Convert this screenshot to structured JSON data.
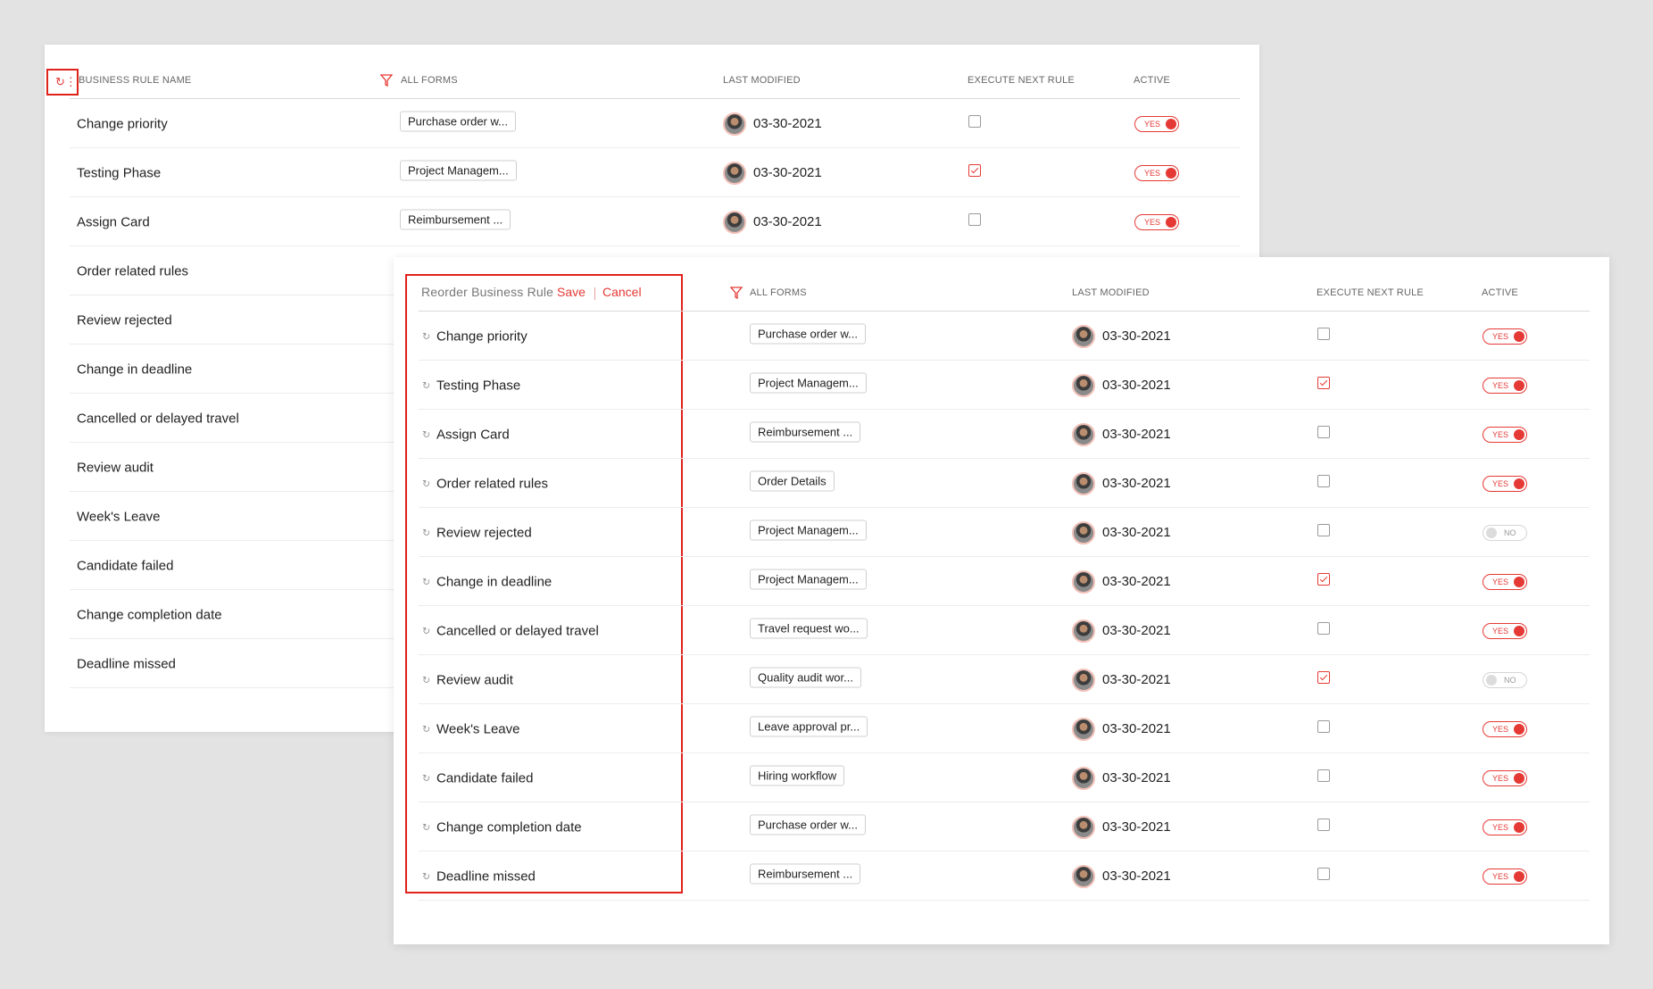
{
  "colors": {
    "accent": "#e53935",
    "highlight": "#e0221b",
    "background": "#e3e3e3"
  },
  "back_table": {
    "reorder_icon": "reorder-icon",
    "headers": {
      "name": "BUSINESS RULE NAME",
      "forms": "ALL FORMS",
      "modified": "LAST MODIFIED",
      "execute": "EXECUTE NEXT RULE",
      "active": "ACTIVE"
    },
    "rows": [
      {
        "name": "Change priority",
        "form": "Purchase order w...",
        "date": "03-30-2021",
        "execute": false,
        "active": "YES"
      },
      {
        "name": "Testing Phase",
        "form": "Project Managem...",
        "date": "03-30-2021",
        "execute": true,
        "active": "YES"
      },
      {
        "name": "Assign Card",
        "form": "Reimbursement ...",
        "date": "03-30-2021",
        "execute": false,
        "active": "YES"
      },
      {
        "name": "Order related rules"
      },
      {
        "name": "Review rejected"
      },
      {
        "name": "Change in deadline"
      },
      {
        "name": "Cancelled or delayed travel"
      },
      {
        "name": "Review audit"
      },
      {
        "name": "Week's Leave"
      },
      {
        "name": "Candidate failed"
      },
      {
        "name": "Change completion date"
      },
      {
        "name": "Deadline missed"
      }
    ]
  },
  "front_table": {
    "title": "Reorder Business Rule",
    "save_label": "Save",
    "cancel_label": "Cancel",
    "headers": {
      "forms": "ALL FORMS",
      "modified": "LAST MODIFIED",
      "execute": "EXECUTE NEXT RULE",
      "active": "ACTIVE"
    },
    "rows": [
      {
        "name": "Change priority",
        "form": "Purchase order w...",
        "date": "03-30-2021",
        "execute": false,
        "active": "YES"
      },
      {
        "name": "Testing Phase",
        "form": "Project Managem...",
        "date": "03-30-2021",
        "execute": true,
        "active": "YES"
      },
      {
        "name": "Assign Card",
        "form": "Reimbursement ...",
        "date": "03-30-2021",
        "execute": false,
        "active": "YES"
      },
      {
        "name": "Order related rules",
        "form": "Order Details",
        "date": "03-30-2021",
        "execute": false,
        "active": "YES"
      },
      {
        "name": "Review rejected",
        "form": "Project Managem...",
        "date": "03-30-2021",
        "execute": false,
        "active": "NO"
      },
      {
        "name": "Change in deadline",
        "form": "Project Managem...",
        "date": "03-30-2021",
        "execute": true,
        "active": "YES"
      },
      {
        "name": "Cancelled or delayed travel",
        "form": "Travel request wo...",
        "date": "03-30-2021",
        "execute": false,
        "active": "YES"
      },
      {
        "name": "Review audit",
        "form": "Quality audit wor...",
        "date": "03-30-2021",
        "execute": true,
        "active": "NO"
      },
      {
        "name": "Week's Leave",
        "form": "Leave approval pr...",
        "date": "03-30-2021",
        "execute": false,
        "active": "YES"
      },
      {
        "name": "Candidate failed",
        "form": "Hiring workflow",
        "date": "03-30-2021",
        "execute": false,
        "active": "YES"
      },
      {
        "name": "Change completion date",
        "form": "Purchase order w...",
        "date": "03-30-2021",
        "execute": false,
        "active": "YES"
      },
      {
        "name": "Deadline missed",
        "form": "Reimbursement ...",
        "date": "03-30-2021",
        "execute": false,
        "active": "YES"
      }
    ]
  }
}
